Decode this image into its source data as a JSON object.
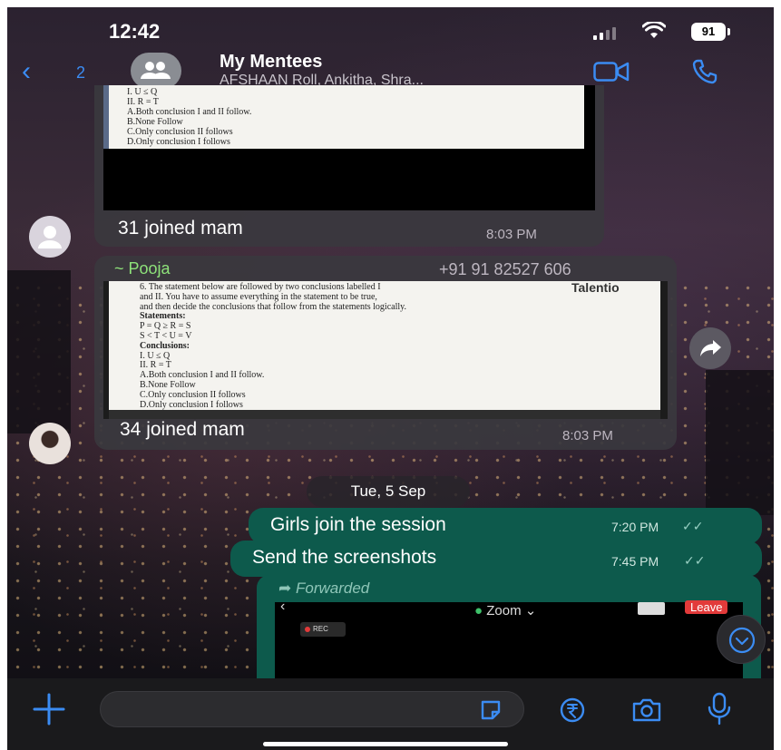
{
  "status_bar": {
    "time": "12:42",
    "battery": "91"
  },
  "header": {
    "back_count": "2",
    "title": "My Mentees",
    "subtitle": "AFSHAAN Roll, Ankitha, Shra..."
  },
  "messages": {
    "first": {
      "image_lines": [
        "I.  U ≤ Q",
        "II. R = T",
        "A.Both conclusion I and II follow.",
        "B.None Follow",
        "C.Only conclusion II follows",
        "D.Only conclusion I follows"
      ],
      "caption": "31 joined mam",
      "time": "8:03 PM"
    },
    "second": {
      "sender": "~ Pooja",
      "phone": "+91 91 82527 606",
      "watermark": "Talentio",
      "image_lines": [
        "6. The statement below are followed by two conclusions labelled I",
        "and II. You have to assume everything in the statement to be true,",
        "and then decide the conclusions that follow from the statements logically.",
        "Statements:",
        "P = Q ≥ R = S",
        "S < T < U = V",
        "Conclusions:",
        "I.  U ≤ Q",
        "II. R = T",
        "A.Both conclusion I and II follow.",
        "B.None Follow",
        "C.Only conclusion II follows",
        "D.Only conclusion I follows"
      ],
      "caption": "34 joined mam",
      "time": "8:03 PM"
    },
    "date_separator": "Tue, 5 Sep",
    "outgoing": [
      {
        "text": "Girls join the session",
        "time": "7:20 PM"
      },
      {
        "text": "Send the screenshots",
        "time": "7:45 PM"
      }
    ],
    "forwarded": {
      "label": "Forwarded",
      "zoom_label": "Zoom",
      "leave_label": "Leave",
      "rec_label": "REC"
    }
  },
  "input_bar": {
    "placeholder": ""
  },
  "colors": {
    "accent_blue": "#3b8cf3",
    "outgoing_bubble": "#0d5a4c",
    "sender_green": "#8ee27a"
  }
}
